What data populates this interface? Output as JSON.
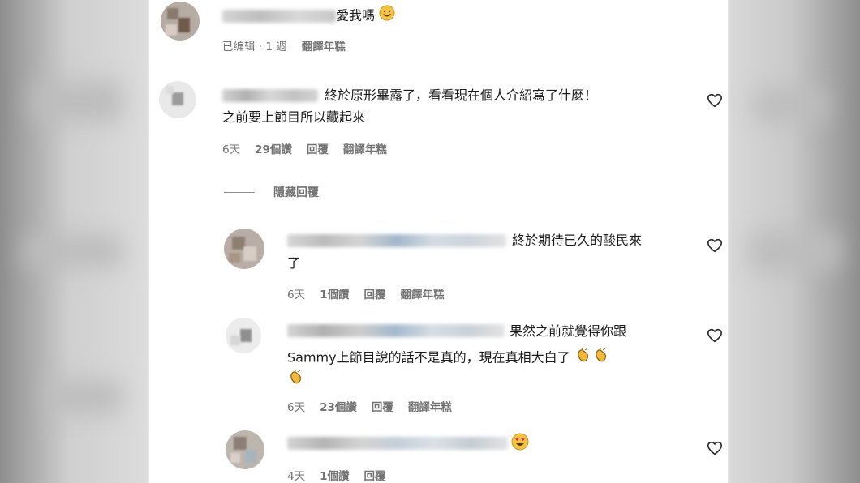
{
  "colors": {
    "text": "#1b1b1b",
    "meta": "#737373",
    "background": "#ffffff"
  },
  "top_comment": {
    "text": "愛我嗎",
    "emoji": "smiling-face-icon",
    "meta": {
      "edited": "已编辑 · 1 週",
      "translate": "翻譯年糕"
    }
  },
  "comment_main": {
    "line1": "終於原形畢露了，看看現在個人介紹寫了什麼！",
    "line2": "之前要上節目所以藏起來",
    "meta": {
      "time": "6天",
      "likes": "29個讚",
      "reply": "回覆",
      "translate": "翻譯年糕"
    }
  },
  "hide_replies": "隱藏回覆",
  "reply1": {
    "line1": "終於期待已久的酸民來",
    "line2": "了",
    "meta": {
      "time": "6天",
      "likes": "1個讚",
      "reply": "回覆",
      "translate": "翻譯年糕"
    }
  },
  "reply2": {
    "line1": "果然之前就覺得你跟",
    "line2": "Sammy上節目說的話不是真的，現在真相大白了",
    "emoji": "clapping-hands-icon",
    "meta": {
      "time": "6天",
      "likes": "23個讚",
      "reply": "回覆",
      "translate": "翻譯年糕"
    }
  },
  "reply3": {
    "emoji": "heart-eyes-icon",
    "meta": {
      "time": "4天",
      "likes": "1個讚",
      "reply": "回覆"
    }
  }
}
